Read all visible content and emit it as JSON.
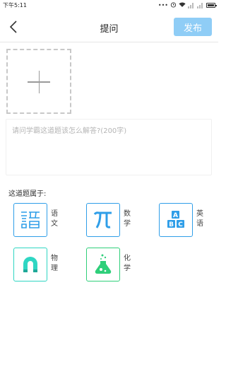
{
  "status_bar": {
    "time": "下午5:11"
  },
  "header": {
    "title": "提问",
    "publish_label": "发布"
  },
  "question": {
    "placeholder": "请问学霸这道题该怎么解答?(200字)",
    "value": ""
  },
  "belongs_label": "这道题属于:",
  "subjects": [
    {
      "name": "语文",
      "color": "#2f9ee8"
    },
    {
      "name": "数学",
      "color": "#2f9ee8"
    },
    {
      "name": "英语",
      "color": "#2f9ee8"
    },
    {
      "name": "物理",
      "color": "#2fd6c3"
    },
    {
      "name": "化学",
      "color": "#2fcf7a"
    }
  ]
}
